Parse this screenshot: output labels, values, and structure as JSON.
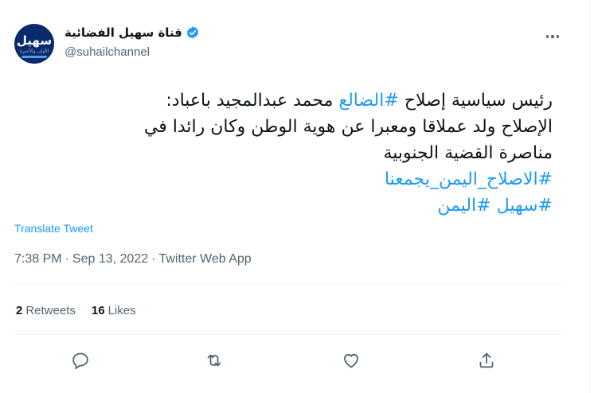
{
  "account": {
    "display_name": "قناة سهيل الفضائية",
    "handle": "@suhailchannel",
    "avatar_text": "سهيل",
    "avatar_subtext": "الأولى والأخيرة",
    "verified": true
  },
  "tweet": {
    "line1_plain_a": "رئيس سياسية إصلاح ",
    "line1_hashtag": "#الضالع",
    "line1_plain_b": " محمد عبدالمجيد باعباد:",
    "line2": "الإصلاح ولد عملاقا ومعبرا عن هوية الوطن وكان رائدا في",
    "line3": "مناصرة القضية الجنوبية",
    "hashtag_line": "#الاصلاح_اليمن_يجمعنا",
    "hashtag_a": "#سهيل",
    "hashtag_b": "#اليمن"
  },
  "translate_label": "Translate Tweet",
  "meta": {
    "time": "7:38 PM",
    "sep1": "·",
    "date": "Sep 13, 2022",
    "sep2": "·",
    "source": "Twitter Web App"
  },
  "stats": {
    "retweets_count": "2",
    "retweets_label": "Retweets",
    "likes_count": "16",
    "likes_label": "Likes"
  },
  "icons": {
    "reply": "reply-icon",
    "retweet": "retweet-icon",
    "like": "heart-icon",
    "share": "share-icon",
    "more": "more-icon",
    "verified": "verified-badge-icon"
  },
  "colors": {
    "accent": "#1d9bf0",
    "text": "#0f1419",
    "muted": "#536471",
    "avatar_bg": "#0b2a6b"
  }
}
